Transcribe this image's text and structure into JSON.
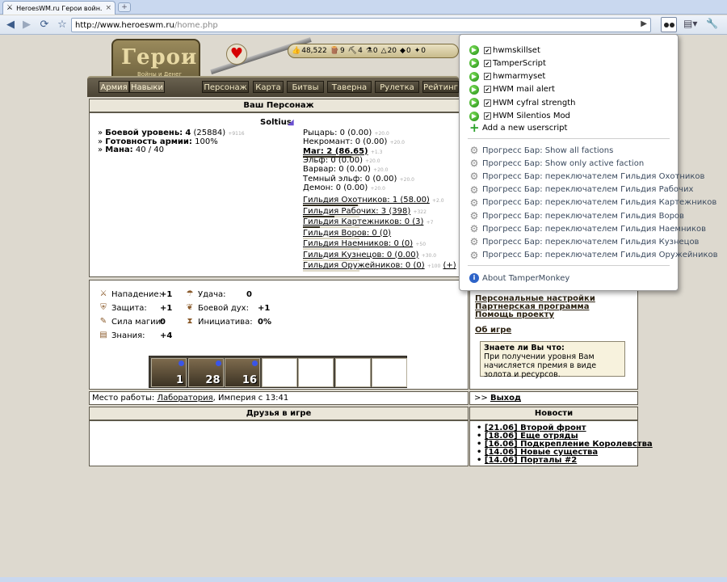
{
  "browser": {
    "tab_title": "HeroesWM.ru Герои войн...",
    "tab_close": "×",
    "new_tab": "+",
    "url_host": "http://www.heroeswm.ru",
    "url_path": "/home.php"
  },
  "header": {
    "logo_text": "Герои",
    "logo_sub": "Войны и Денег",
    "resources": [
      {
        "icon": "gold-icon",
        "value": "48,522"
      },
      {
        "icon": "wood-icon",
        "value": "9"
      },
      {
        "icon": "ore-icon",
        "value": "4"
      },
      {
        "icon": "mercury-icon",
        "value": "0"
      },
      {
        "icon": "sulfur-icon",
        "value": "20"
      },
      {
        "icon": "crystal-icon",
        "value": "0"
      },
      {
        "icon": "gems-icon",
        "value": "0"
      }
    ],
    "nav": [
      "Армия",
      "Навыки",
      "Персонаж",
      "Карта",
      "Битвы",
      "Таверна",
      "Рулетка",
      "Рейтинг"
    ]
  },
  "character": {
    "section_title": "Ваш Персонаж",
    "name": "Soltius",
    "level_label": "Боевой уровень:",
    "level": "4",
    "level_exp": "(25884)",
    "level_next": "+9116",
    "readiness_label": "Готовность армии:",
    "readiness": "100%",
    "mana_label": "Мана:",
    "mana": "40 / 40",
    "factions": [
      {
        "label": "Рыцарь: 0 (0.00)",
        "next": "+20.0",
        "underline": false
      },
      {
        "label": "Некромант: 0 (0.00)",
        "next": "+20.0",
        "underline": false
      },
      {
        "label": "Маг: 2 (86.65)",
        "next": "+1.3",
        "underline": true,
        "bold": true,
        "fill": 0.86
      },
      {
        "label": "Эльф: 0 (0.00)",
        "next": "+20.0",
        "underline": false
      },
      {
        "label": "Варвар: 0 (0.00)",
        "next": "+20.0",
        "underline": false
      },
      {
        "label": "Темный эльф: 0 (0.00)",
        "next": "+20.0",
        "underline": false
      },
      {
        "label": "Демон: 0 (0.00)",
        "next": "+20.0",
        "underline": false
      }
    ],
    "guilds": [
      {
        "label": "Гильдия Охотников: 1 (58.00)",
        "next": "+2.0",
        "fill": 0.97
      },
      {
        "label": "Гильдия Рабочих: 3 (398)",
        "next": "+322",
        "fill": 0.55
      },
      {
        "label": "Гильдия Картежников: 0 (3)",
        "next": "+7",
        "fill": 0.3
      },
      {
        "label": "Гильдия Воров: 0 (0)",
        "next": "",
        "fill": 0.0
      },
      {
        "label": "Гильдия Наемников: 0 (0)",
        "next": "+50",
        "fill": 0.0
      },
      {
        "label": "Гильдия Кузнецов: 0 (0.00)",
        "next": "+30.0",
        "fill": 0.0
      },
      {
        "label": "Гильдия Оружейников: 0 (0)",
        "next": "+100",
        "extra": "(+)",
        "fill": 0.0
      }
    ]
  },
  "attributes": [
    {
      "icon": "attack-icon",
      "label": "Нападение:",
      "value": "+1"
    },
    {
      "icon": "defense-icon",
      "label": "Защита:",
      "value": "+1"
    },
    {
      "icon": "magic-power-icon",
      "label": "Сила магии:",
      "value": "0"
    },
    {
      "icon": "knowledge-icon",
      "label": "Знания:",
      "value": "+4"
    },
    {
      "icon": "luck-icon",
      "label": "Удача:",
      "value": "0"
    },
    {
      "icon": "morale-icon",
      "label": "Боевой дух:",
      "value": "+1"
    },
    {
      "icon": "initiative-icon",
      "label": "Инициатива:",
      "value": "0%"
    }
  ],
  "army": [
    "1",
    "28",
    "16",
    "",
    "",
    "",
    ""
  ],
  "side_links": [
    "Персональные настройки",
    "Партнерская программа",
    "Помощь проекту",
    "Об игре"
  ],
  "tip": {
    "title": "Знаете ли Вы что:",
    "text": "При получении уровня Вам начисляется премия в виде золота и ресурсов."
  },
  "work": {
    "label": "Место работы:",
    "place": "Лаборатория",
    "rest": ", Империя с 13:41"
  },
  "logout": {
    "prefix": ">>",
    "label": "Выход"
  },
  "friends_title": "Друзья в игре",
  "news_title": "Новости",
  "news": [
    "[21.06] Второй фронт",
    "[18.06] Еще отряды",
    "[16.06] Подкрепление Королевства",
    "[14.06] Новые существа",
    "[14.06] Порталы #2"
  ],
  "popup": {
    "scripts": [
      "hwmskillset",
      "TamperScript",
      "hwmarmyset",
      "HWM mail alert",
      "HWM cyfral strength",
      "HWM Silentios Mod"
    ],
    "add_new": "Add a new userscript",
    "commands": [
      "Прогресс Бар: Show all factions",
      "Прогресс Бар: Show only active faction",
      "Прогресс Бар: переключателем Гильдия Охотников",
      "Прогресс Бар: переключателем Гильдия Рабочих",
      "Прогресс Бар: переключателем Гильдия Картежников",
      "Прогресс Бар: переключателем Гильдия Воров",
      "Прогресс Бар: переключателем Гильдия Наемников",
      "Прогресс Бар: переключателем Гильдия Кузнецов",
      "Прогресс Бар: переключателем Гильдия Оружейников"
    ],
    "about": "About TamperMonkey"
  }
}
